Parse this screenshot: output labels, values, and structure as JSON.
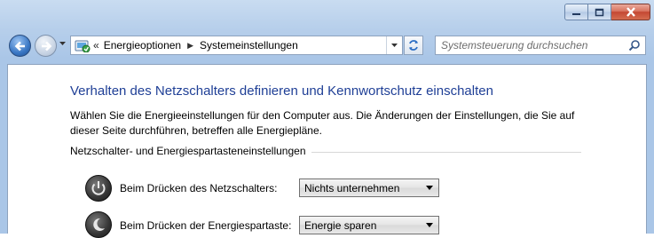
{
  "window": {
    "caption_buttons": [
      "minimize-icon",
      "maximize-icon",
      "close-icon"
    ]
  },
  "nav": {
    "back_icon": "back-arrow-icon",
    "forward_icon": "forward-arrow-icon"
  },
  "address": {
    "overflow": "«",
    "crumbs": [
      "Energieoptionen",
      "Systemeinstellungen"
    ]
  },
  "search": {
    "placeholder": "Systemsteuerung durchsuchen"
  },
  "main": {
    "title": "Verhalten des Netzschalters definieren und Kennwortschutz einschalten",
    "description": "Wählen Sie die Energieeinstellungen für den Computer aus. Die Änderungen der Einstellungen, die Sie auf dieser Seite durchführen, betreffen alle Energiepläne.",
    "group_title": "Netzschalter- und Energiespartasteneinstellungen",
    "settings": [
      {
        "label": "Beim Drücken des Netzschalters:",
        "value": "Nichts unternehmen"
      },
      {
        "label": "Beim Drücken der Energiespartaste:",
        "value": "Energie sparen"
      }
    ]
  },
  "colors": {
    "title": "#1f3f96",
    "frame": "#b7cfeb",
    "close_button": "#c44833"
  }
}
